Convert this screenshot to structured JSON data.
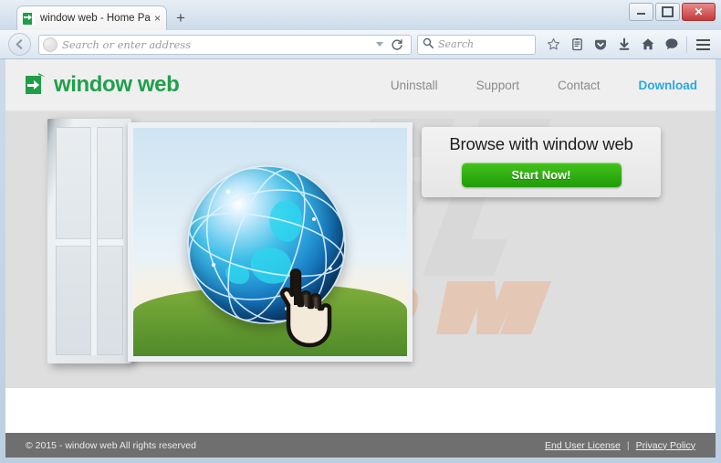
{
  "browser": {
    "tab": {
      "title": "window web - Home Page",
      "favicon": "window-web-door-arrow-icon",
      "close_label": "×"
    },
    "new_tab_label": "+",
    "window_controls": {
      "minimize": "minimize-icon",
      "maximize": "maximize-icon",
      "close": "✕"
    },
    "address_bar": {
      "placeholder": "Search or enter address",
      "value": "",
      "identity_icon": "page-globe-icon",
      "dropdown_icon": "chevron-down-icon",
      "reload_icon": "reload-icon"
    },
    "search_bar": {
      "placeholder": "Search",
      "value": "",
      "icon": "search-icon"
    },
    "back_icon": "back-arrow-icon",
    "toolbar_icons": [
      {
        "name": "bookmark-star-icon",
        "label": "Bookmark"
      },
      {
        "name": "reader-view-icon",
        "label": "Reader View"
      },
      {
        "name": "pocket-icon",
        "label": "Pocket"
      },
      {
        "name": "downloads-icon",
        "label": "Downloads"
      },
      {
        "name": "home-icon",
        "label": "Home"
      },
      {
        "name": "sync-chat-icon",
        "label": "Sync"
      }
    ],
    "menu_icon": "hamburger-menu-icon"
  },
  "site": {
    "brand": {
      "name": "window web",
      "logo_icon": "door-arrow-logo-icon",
      "color": "#20a04b"
    },
    "nav": [
      {
        "label": "Uninstall",
        "accent": false
      },
      {
        "label": "Support",
        "accent": false
      },
      {
        "label": "Contact",
        "accent": false
      },
      {
        "label": "Download",
        "accent": true
      }
    ],
    "accent_color": "#29a8e0",
    "hero": {
      "illustration": "open-window-globe-cursor-illustration",
      "watermark_text": ".com",
      "callout": {
        "title": "Browse with window web",
        "button_label": "Start Now!",
        "button_color": "#34b415"
      }
    },
    "footer": {
      "copyright": "© 2015 - window web All rights reserved",
      "links": [
        {
          "label": "End User License"
        },
        {
          "label": "Privacy Policy"
        }
      ],
      "separator": "|"
    }
  }
}
